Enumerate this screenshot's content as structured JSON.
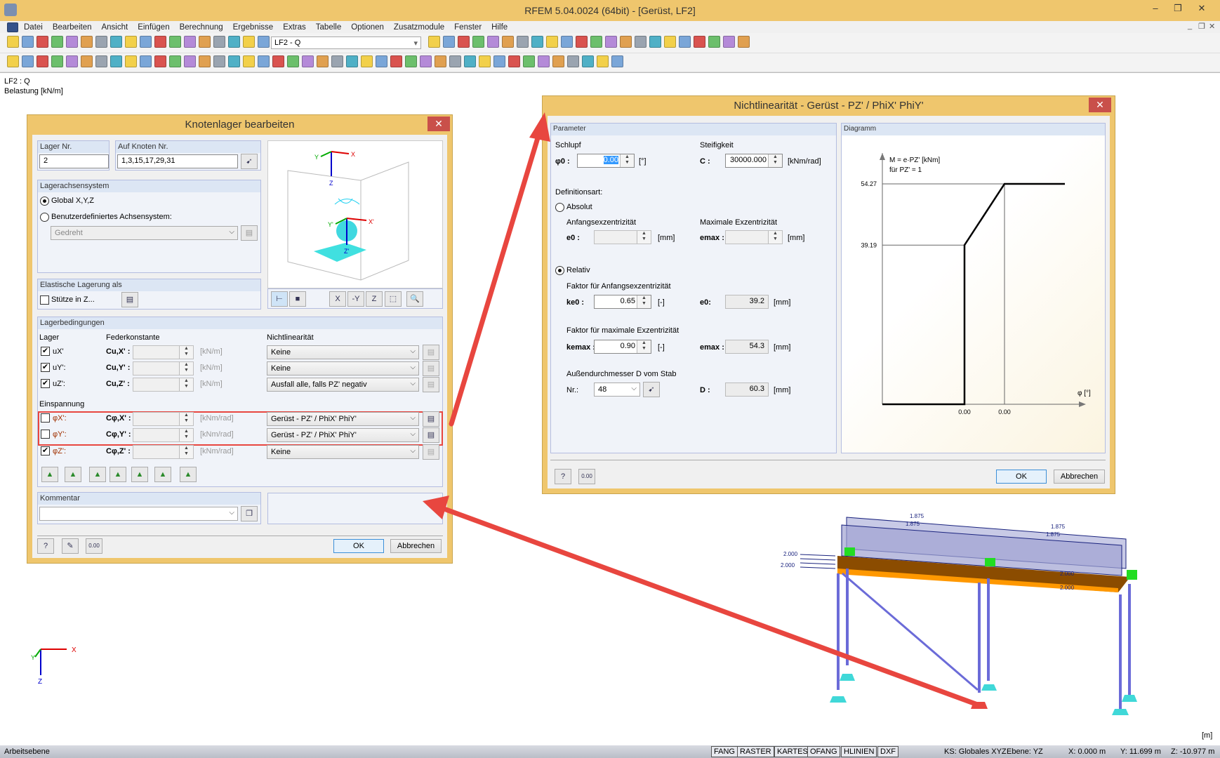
{
  "window": {
    "title": "RFEM 5.04.0024 (64bit) - [Gerüst, LF2]",
    "minimize": "–",
    "maximize": "❐",
    "close": "✕",
    "mdi_min": "_",
    "mdi_restore": "❐",
    "mdi_close": "✕"
  },
  "menu": [
    "Datei",
    "Bearbeiten",
    "Ansicht",
    "Einfügen",
    "Berechnung",
    "Ergebnisse",
    "Extras",
    "Tabelle",
    "Optionen",
    "Zusatzmodule",
    "Fenster",
    "Hilfe"
  ],
  "toolbar1": {
    "icons_before": [
      "new-icon",
      "open-icon",
      "archive-icon",
      "save-as-icon",
      "save-icon",
      "print-preview-icon",
      "print-icon",
      "print-report-icon",
      "undo-icon",
      "redo-icon",
      "node-icon",
      "select-icon",
      "target-icon",
      "window-select-icon",
      "copy-icon",
      "table-icon",
      "grid-icon",
      "load-case-icon"
    ],
    "load_case": "LF2 - Q",
    "icons_after": [
      "prev-icon",
      "next-icon",
      "show-loads-icon",
      "show-values-icon",
      "results-icon",
      "values-off-icon",
      "deformation-icon",
      "section-icon",
      "panel-icon",
      "view-icon",
      "active-view-icon",
      "render-icon",
      "member-icon",
      "solid-icon",
      "cut-icon",
      "spring-icon",
      "scale-icon",
      "filter-icon",
      "print-graphic-icon",
      "export-icon",
      "report-icon",
      "pdf-icon"
    ]
  },
  "toolbar2": {
    "icons": [
      "new-node-icon",
      "line-icon",
      "member-icon",
      "arc-icon",
      "support-icon",
      "hinge-icon",
      "surface-icon",
      "dimension-icon",
      "guideline-icon",
      "grid-point-icon",
      "move-icon",
      "frame-icon",
      "3d-icon",
      "solid-icon",
      "box-icon",
      "divide-icon",
      "load-icon",
      "load-member-icon",
      "load-surface-icon",
      "generate-load-icon",
      "wind-icon",
      "zoom-all-icon",
      "zoom-icon",
      "zoom-out-icon",
      "iso-view-icon",
      "perspective-icon",
      "view-x-icon",
      "view-y-icon",
      "view-z-icon",
      "view-minus-x-icon",
      "measure-icon",
      "render-mode-icon",
      "coordinate-icon",
      "visibility-icon",
      "hide-icon",
      "plane-icon",
      "panel-icon",
      "color-icon",
      "line-weight-icon",
      "tables-icon",
      "report-icon",
      "check-icon"
    ]
  },
  "canvas": {
    "loadcase": "LF2 : Q",
    "load_label": "Belastung [kN/m]",
    "unit": "[m]",
    "axis": {
      "x": "X",
      "y": "Y",
      "z": "Z"
    },
    "load_values": [
      "1.875",
      "1.875",
      "1.875",
      "1.875",
      "2.000",
      "2.000",
      "2.000",
      "2.000"
    ]
  },
  "knotenlager": {
    "title": "Knotenlager bearbeiten",
    "close": "✕",
    "lager_nr": {
      "label": "Lager Nr.",
      "value": "2"
    },
    "knoten": {
      "label": "Auf Knoten Nr.",
      "value": "1,3,15,17,29,31"
    },
    "achsensystem": {
      "label": "Lagerachsensystem",
      "global": "Global X,Y,Z",
      "user": "Benutzerdefiniertes Achsensystem:",
      "user_value": "Gedreht",
      "selected": "global"
    },
    "preview": {
      "x": "X",
      "y": "Y",
      "z": "Z",
      "x2": "X'",
      "y2": "Y'",
      "z2": "Z'"
    },
    "elastisch": {
      "label": "Elastische Lagerung als",
      "stuetze": "Stütze in Z...",
      "checked": false
    },
    "bedingungen": {
      "label": "Lagerbedingungen",
      "col_lager": "Lager",
      "col_feder": "Federkonstante",
      "col_nl": "Nichtlinearität",
      "einspannung": "Einspannung",
      "rows": [
        {
          "name": "uX'",
          "const": "Cu,X' :",
          "unit": "[kN/m]",
          "nl": "Keine",
          "checked": true
        },
        {
          "name": "uY':",
          "const": "Cu,Y' :",
          "unit": "[kN/m]",
          "nl": "Keine",
          "checked": true
        },
        {
          "name": "uZ':",
          "const": "Cu,Z' :",
          "unit": "[kN/m]",
          "nl": "Ausfall alle, falls PZ' negativ",
          "checked": true
        },
        {
          "name": "φX':",
          "const": "Cφ,X' :",
          "unit": "[kNm/rad]",
          "nl": "Gerüst - PZ' / PhiX' PhiY'",
          "checked": false
        },
        {
          "name": "φY':",
          "const": "Cφ,Y' :",
          "unit": "[kNm/rad]",
          "nl": "Gerüst - PZ' / PhiX' PhiY'",
          "checked": false
        },
        {
          "name": "φZ':",
          "const": "Cφ,Z' :",
          "unit": "[kNm/rad]",
          "nl": "Keine",
          "checked": true
        }
      ]
    },
    "kommentar": {
      "label": "Kommentar",
      "value": ""
    },
    "ok": "OK",
    "cancel": "Abbrechen",
    "check": "✔"
  },
  "nichtlinearitaet": {
    "title": "Nichtlinearität - Gerüst - PZ' / PhiX' PhiY'",
    "close": "✕",
    "parameter_label": "Parameter",
    "diagram_label": "Diagramm",
    "schlupf": "Schlupf",
    "phi0_label": "φ0 :",
    "phi0": "0.00",
    "phi0_unit": "[°]",
    "steifigkeit": "Steifigkeit",
    "c_label": "C :",
    "c": "30000.000",
    "c_unit": "[kNm/rad]",
    "definitionsart": "Definitionsart:",
    "absolut": "Absolut",
    "relativ": "Relativ",
    "selected": "relativ",
    "anfangsexz": "Anfangsexzentrizität",
    "maxexz": "Maximale Exzentrizität",
    "e0_label": "e0 :",
    "emax_label": "emax :",
    "mm": "[mm]",
    "dash": "[-]",
    "faktor_anf": "Faktor für Anfangsexzentrizität",
    "ke0_label": "ke0 :",
    "ke0": "0.65",
    "e0r_label": "e0:",
    "e0": "39.2",
    "faktor_max": "Faktor für maximale Exzentrizität",
    "kemax_label": "kemax :",
    "kemax": "0.90",
    "emax": "54.3",
    "aussendurch": "Außendurchmesser D vom Stab",
    "nr_label": "Nr.:",
    "nr": "48",
    "d_label": "D :",
    "d": "60.3",
    "ok": "OK",
    "cancel": "Abbrechen"
  },
  "chart_data": {
    "type": "line",
    "ylabel": "M = e·PZ' [kNm]",
    "ylabel2": "für PZ' = 1",
    "xlabel": "φ [°]",
    "y_ticks": [
      "54.27",
      "39.19"
    ],
    "x_ticks": [
      "0.00",
      "0.00"
    ],
    "points": [
      {
        "phi": "0.00",
        "M": 0
      },
      {
        "phi": "0.00",
        "M": 39.19
      },
      {
        "phi": "0.00",
        "M": 54.27
      }
    ],
    "ylim": [
      0,
      54.27
    ],
    "line_color": "#000000"
  },
  "status": {
    "left": "Arbeitsebene",
    "toggles": [
      "FANG",
      "RASTER",
      "KARTES",
      "OFANG",
      "HLINIEN",
      "DXF"
    ],
    "ks": "KS: Globales XYZ",
    "ebene": "Ebene: YZ",
    "x": "X:  0.000 m",
    "y": "Y:  11.699 m",
    "z": "Z:  -10.977 m"
  },
  "colors": {
    "titlebar": "#efc66d",
    "annotation": "#e8463f",
    "close": "#c9504a"
  }
}
